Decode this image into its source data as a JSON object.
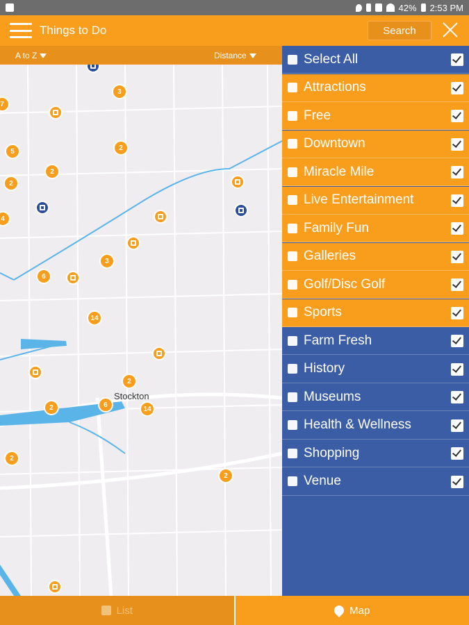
{
  "status_bar": {
    "battery": "42%",
    "time": "2:53 PM"
  },
  "header": {
    "title": "Things to Do",
    "search_label": "Search"
  },
  "sort_bar": {
    "az_label": "A to Z",
    "distance_label": "Distance"
  },
  "map": {
    "city_label": "Stockton",
    "clusters": [
      "3",
      "7",
      "2",
      "5",
      "2",
      "2",
      "4",
      "3",
      "6",
      "14",
      "2",
      "2",
      "6",
      "14",
      "2",
      "2"
    ]
  },
  "filters": [
    {
      "label": "Select All",
      "icon": "list-icon",
      "checked": true,
      "color": "blue"
    },
    {
      "label": "Attractions",
      "icon": "attractions-icon",
      "checked": true,
      "color": "orange"
    },
    {
      "label": "Free",
      "icon": "tag-icon",
      "checked": true,
      "color": "orange"
    },
    {
      "label": "Downtown",
      "icon": "buildings-icon",
      "checked": true,
      "color": "orange"
    },
    {
      "label": "Miracle Mile",
      "icon": "road-icon",
      "checked": true,
      "color": "orange"
    },
    {
      "label": "Live Entertainment",
      "icon": "performer-icon",
      "checked": true,
      "color": "orange"
    },
    {
      "label": "Family Fun",
      "icon": "family-icon",
      "checked": true,
      "color": "orange"
    },
    {
      "label": "Galleries",
      "icon": "palette-icon",
      "checked": true,
      "color": "orange"
    },
    {
      "label": "Golf/Disc Golf",
      "icon": "golf-icon",
      "checked": true,
      "color": "orange"
    },
    {
      "label": "Sports",
      "icon": "sneaker-icon",
      "checked": true,
      "color": "orange"
    },
    {
      "label": "Farm Fresh",
      "icon": "cow-icon",
      "checked": true,
      "color": "blue"
    },
    {
      "label": "History",
      "icon": "monument-icon",
      "checked": true,
      "color": "blue"
    },
    {
      "label": "Museums",
      "icon": "mask-icon",
      "checked": true,
      "color": "blue"
    },
    {
      "label": "Health & Wellness",
      "icon": "swimmer-icon",
      "checked": true,
      "color": "blue"
    },
    {
      "label": "Shopping",
      "icon": "bag-icon",
      "checked": true,
      "color": "blue"
    },
    {
      "label": "Venue",
      "icon": "venue-icon",
      "checked": true,
      "color": "blue"
    }
  ],
  "tabs": {
    "list_label": "List",
    "map_label": "Map"
  },
  "colors": {
    "orange": "#f99d1c",
    "blue": "#3a5da5",
    "dark_orange": "#e8901c"
  }
}
